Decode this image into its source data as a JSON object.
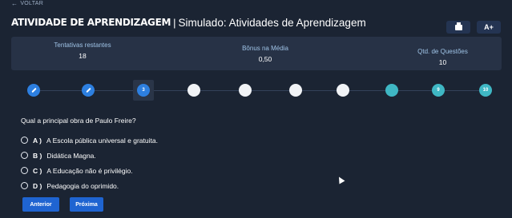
{
  "nav": {
    "back_label": "VOLTAR"
  },
  "header": {
    "title_strong": "ATIVIDADE DE APRENDIZAGEM",
    "separator": "|",
    "title_sub": "Simulado: Atividades de Aprendizagem",
    "font_button_label": "A+"
  },
  "stats": [
    {
      "label": "Tentativas restantes",
      "value": "18"
    },
    {
      "label": "Bônus na Média",
      "value": "0,50"
    },
    {
      "label": "Qtd. de Questões",
      "value": "10"
    }
  ],
  "steps": [
    {
      "state": "done",
      "label": ""
    },
    {
      "state": "done",
      "label": ""
    },
    {
      "state": "current",
      "label": "3"
    },
    {
      "state": "empty",
      "label": ""
    },
    {
      "state": "empty",
      "label": ""
    },
    {
      "state": "empty",
      "label": ""
    },
    {
      "state": "empty",
      "label": ""
    },
    {
      "state": "teal",
      "label": ""
    },
    {
      "state": "teal",
      "label": "9"
    },
    {
      "state": "teal",
      "label": "10"
    }
  ],
  "question": {
    "text": "Qual a principal obra de Paulo Freire?",
    "options": [
      {
        "letter": "A )",
        "text": "A Escola pública universal e gratuita."
      },
      {
        "letter": "B )",
        "text": "Didática Magna."
      },
      {
        "letter": "C )",
        "text": "A Educação não é privilégio."
      },
      {
        "letter": "D )",
        "text": "Pedagogia do oprimido."
      }
    ]
  },
  "buttons": {
    "prev_label": "Anterior",
    "next_label": "Próxima"
  },
  "colors": {
    "background": "#1b2433",
    "card": "#273246",
    "accent": "#2d7fe0",
    "button": "#1f64d1"
  }
}
